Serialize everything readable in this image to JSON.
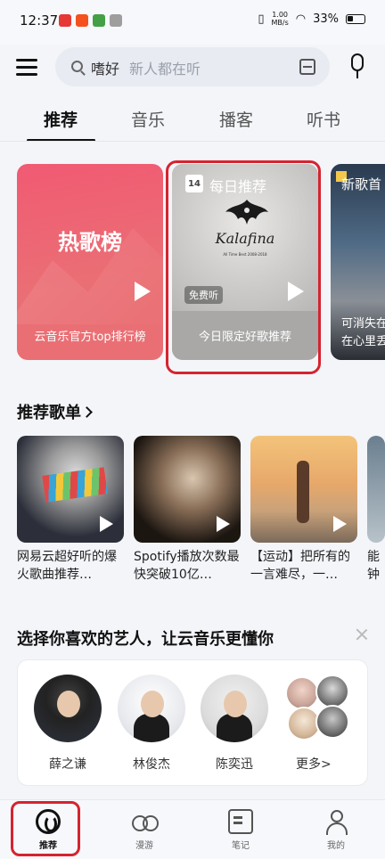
{
  "status_bar": {
    "time": "12:37",
    "speed": "1.00\nMB/s",
    "battery": "33%",
    "notification_colors": [
      "#e53935",
      "#f4511e",
      "#43a047",
      "#9e9e9e"
    ]
  },
  "search": {
    "query": "嗜好",
    "hint": "新人都在听"
  },
  "tabs": [
    {
      "label": "推荐",
      "active": true
    },
    {
      "label": "音乐",
      "active": false
    },
    {
      "label": "播客",
      "active": false
    },
    {
      "label": "听书",
      "active": false
    }
  ],
  "banners": [
    {
      "title": "热歌榜",
      "caption": "云音乐官方top排行榜"
    },
    {
      "title": "每日推荐",
      "calendar_day": "14",
      "album_logo": "Kalafina",
      "album_sub": "All Time Best 2008-2018",
      "free_tag": "免费听",
      "caption": "今日限定好歌推荐"
    },
    {
      "title": "新歌首",
      "caption_line1": "可消失在",
      "caption_line2": "在心里丢"
    }
  ],
  "playlists": {
    "section_title": "推荐歌单",
    "items": [
      {
        "title": "网易云超好听的爆火歌曲推荐…"
      },
      {
        "title": "Spotify播放次数最快突破10亿…"
      },
      {
        "title": "【运动】把所有的一言难尽，一…"
      },
      {
        "title": "能钟"
      }
    ]
  },
  "artists": {
    "section_title": "选择你喜欢的艺人，让云音乐更懂你",
    "items": [
      {
        "name": "薛之谦"
      },
      {
        "name": "林俊杰"
      },
      {
        "name": "陈奕迅"
      }
    ],
    "more_label": "更多>"
  },
  "bottom_nav": [
    {
      "label": "推荐",
      "icon": "netease-music-icon",
      "active": true
    },
    {
      "label": "漫游",
      "icon": "infinity-icon",
      "active": false
    },
    {
      "label": "笔记",
      "icon": "note-icon",
      "active": false
    },
    {
      "label": "我的",
      "icon": "user-icon",
      "active": false
    }
  ],
  "colors": {
    "accent_red": "#d6232f",
    "hot_chart": "#ef6074",
    "background": "#f3f5f9"
  }
}
